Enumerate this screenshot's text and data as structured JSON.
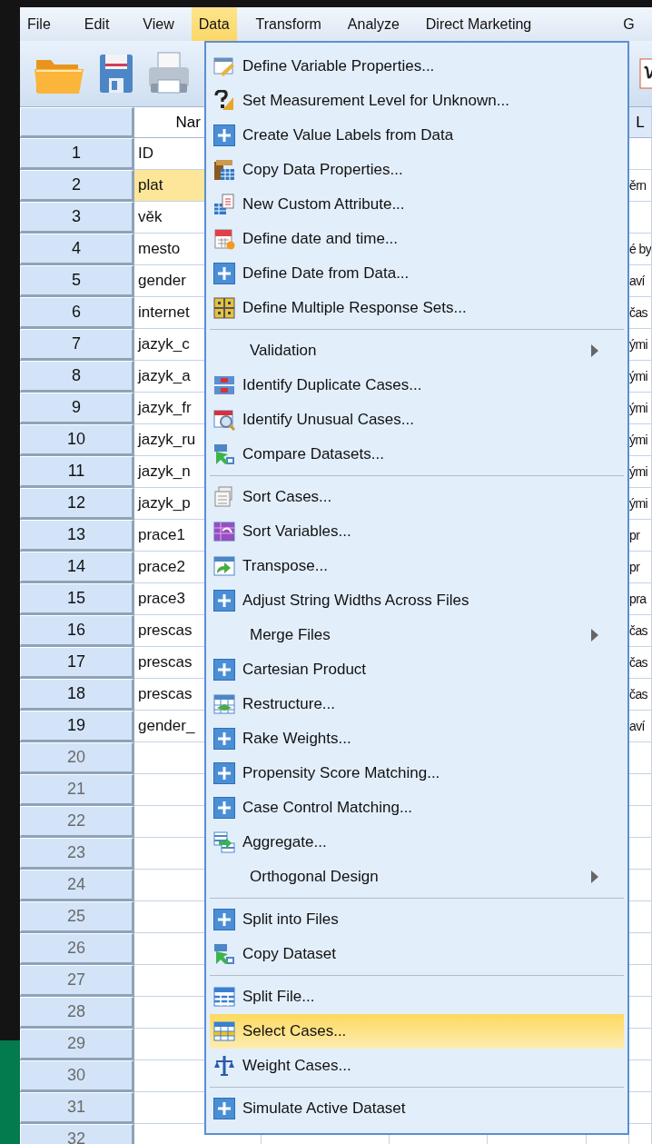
{
  "menu_bar": [
    {
      "label": "File",
      "selected": false
    },
    {
      "label": "Edit",
      "selected": false
    },
    {
      "label": "View",
      "selected": false
    },
    {
      "label": "Data",
      "selected": true
    },
    {
      "label": "Transform",
      "selected": false
    },
    {
      "label": "Analyze",
      "selected": false
    },
    {
      "label": "Direct Marketing",
      "selected": false
    },
    {
      "label": "G",
      "selected": false
    }
  ],
  "table": {
    "columns": [
      {
        "label": "Nar"
      },
      {
        "label": "L"
      }
    ],
    "rows": [
      {
        "number": "1",
        "name": "ID",
        "label": "",
        "selected": false
      },
      {
        "number": "2",
        "name": "plat",
        "label": "ěrn",
        "selected": true
      },
      {
        "number": "3",
        "name": "věk",
        "label": "",
        "selected": false
      },
      {
        "number": "4",
        "name": "mesto",
        "label": "é by",
        "selected": false
      },
      {
        "number": "5",
        "name": "gender",
        "label": "aví",
        "selected": false
      },
      {
        "number": "6",
        "name": "internet",
        "label": "čas",
        "selected": false
      },
      {
        "number": "7",
        "name": "jazyk_c",
        "label": "ými",
        "selected": false
      },
      {
        "number": "8",
        "name": "jazyk_a",
        "label": "ými",
        "selected": false
      },
      {
        "number": "9",
        "name": "jazyk_fr",
        "label": "ými",
        "selected": false
      },
      {
        "number": "10",
        "name": "jazyk_ru",
        "label": "ými",
        "selected": false
      },
      {
        "number": "11",
        "name": "jazyk_n",
        "label": "ými",
        "selected": false
      },
      {
        "number": "12",
        "name": "jazyk_p",
        "label": "ými",
        "selected": false
      },
      {
        "number": "13",
        "name": "prace1",
        "label": "pr",
        "selected": false
      },
      {
        "number": "14",
        "name": "prace2",
        "label": "pr",
        "selected": false
      },
      {
        "number": "15",
        "name": "prace3",
        "label": "pra",
        "selected": false
      },
      {
        "number": "16",
        "name": "prescas",
        "label": "čas",
        "selected": false
      },
      {
        "number": "17",
        "name": "prescas",
        "label": "čas",
        "selected": false
      },
      {
        "number": "18",
        "name": "prescas",
        "label": "čas",
        "selected": false
      },
      {
        "number": "19",
        "name": "gender_",
        "label": "aví",
        "selected": false
      },
      {
        "number": "20",
        "selected": false
      },
      {
        "number": "21",
        "selected": false
      },
      {
        "number": "22",
        "selected": false
      },
      {
        "number": "23",
        "selected": false
      },
      {
        "number": "24",
        "selected": false
      },
      {
        "number": "25",
        "selected": false
      },
      {
        "number": "26",
        "selected": false
      },
      {
        "number": "27",
        "selected": false
      },
      {
        "number": "28",
        "selected": false
      },
      {
        "number": "29",
        "selected": false
      },
      {
        "number": "30",
        "selected": false
      },
      {
        "number": "31",
        "selected": false
      },
      {
        "number": "32",
        "selected": false
      }
    ]
  },
  "data_menu": {
    "groups": [
      [
        {
          "label": "Define Variable Properties...",
          "selected": false,
          "submenu": false
        },
        {
          "label": "Set Measurement Level for Unknown...",
          "selected": false,
          "submenu": false
        },
        {
          "label": "Create Value Labels from Data",
          "selected": false,
          "submenu": false
        },
        {
          "label": "Copy Data Properties...",
          "selected": false,
          "submenu": false
        },
        {
          "label": "New Custom Attribute...",
          "selected": false,
          "submenu": false
        },
        {
          "label": "Define date and time...",
          "selected": false,
          "submenu": false
        },
        {
          "label": "Define Date from Data...",
          "selected": false,
          "submenu": false
        },
        {
          "label": "Define Multiple Response Sets...",
          "selected": false,
          "submenu": false
        }
      ],
      [
        {
          "label": "Validation",
          "selected": false,
          "submenu": true
        },
        {
          "label": "Identify Duplicate Cases...",
          "selected": false,
          "submenu": false
        },
        {
          "label": "Identify Unusual Cases...",
          "selected": false,
          "submenu": false
        },
        {
          "label": "Compare Datasets...",
          "selected": false,
          "submenu": false
        }
      ],
      [
        {
          "label": "Sort Cases...",
          "selected": false,
          "submenu": false
        },
        {
          "label": "Sort Variables...",
          "selected": false,
          "submenu": false
        },
        {
          "label": "Transpose...",
          "selected": false,
          "submenu": false
        },
        {
          "label": "Adjust String Widths Across Files",
          "selected": false,
          "submenu": false
        },
        {
          "label": "Merge Files",
          "selected": false,
          "submenu": true
        },
        {
          "label": "Cartesian Product",
          "selected": false,
          "submenu": false
        },
        {
          "label": "Restructure...",
          "selected": false,
          "submenu": false
        },
        {
          "label": "Rake Weights...",
          "selected": false,
          "submenu": false
        },
        {
          "label": "Propensity Score Matching...",
          "selected": false,
          "submenu": false
        },
        {
          "label": "Case Control Matching...",
          "selected": false,
          "submenu": false
        },
        {
          "label": "Aggregate...",
          "selected": false,
          "submenu": false
        },
        {
          "label": "Orthogonal Design",
          "selected": false,
          "submenu": true
        }
      ],
      [
        {
          "label": "Split into Files",
          "selected": false,
          "submenu": false
        },
        {
          "label": "Copy Dataset",
          "selected": false,
          "submenu": false
        }
      ],
      [
        {
          "label": "Split File...",
          "selected": false,
          "submenu": false
        },
        {
          "label": "Select Cases...",
          "selected": true,
          "submenu": false
        },
        {
          "label": "Weight Cases...",
          "selected": false,
          "submenu": false
        }
      ],
      [
        {
          "label": "Simulate Active Dataset",
          "selected": false,
          "submenu": false
        }
      ]
    ]
  }
}
